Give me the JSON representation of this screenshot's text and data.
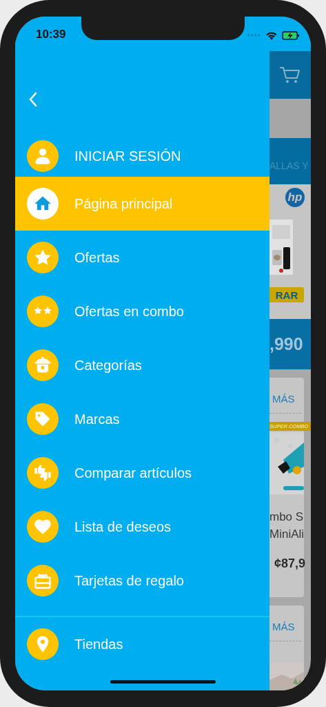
{
  "status_bar": {
    "time": "10:39"
  },
  "drawer": {
    "login_label": "INICIAR SESIÓN",
    "items": [
      {
        "label": "Página principal",
        "selected": true
      },
      {
        "label": "Ofertas",
        "selected": false
      },
      {
        "label": "Ofertas en combo",
        "selected": false
      },
      {
        "label": "Categorías",
        "selected": false
      },
      {
        "label": "Marcas",
        "selected": false
      },
      {
        "label": "Comparar artículos",
        "selected": false
      },
      {
        "label": "Lista de deseos",
        "selected": false
      },
      {
        "label": "Tarjetas de regalo",
        "selected": false
      }
    ],
    "footer_items": [
      {
        "label": "Tiendas",
        "selected": false
      }
    ]
  },
  "background_page": {
    "banner_text": "ALLAS Y",
    "brand_logo_text": "hp",
    "buy_button_label": "RAR",
    "price_banner": ",990",
    "sections": [
      {
        "link": "MÁS",
        "tag": "SUPER COMBO",
        "product_name_lines": [
          "mbo S",
          "MiniAli"
        ],
        "price": "¢87,9"
      },
      {
        "link": "MÁS"
      }
    ]
  }
}
